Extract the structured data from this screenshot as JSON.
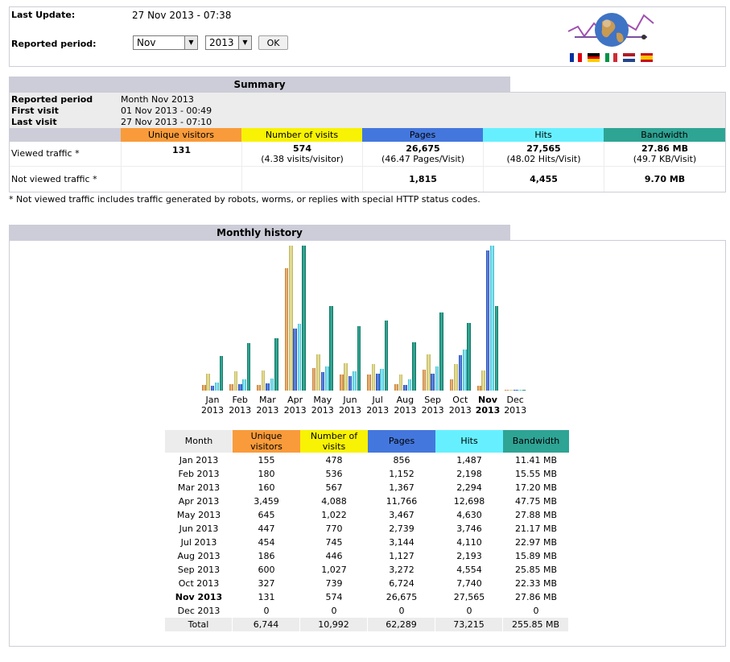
{
  "header": {
    "last_update_label": "Last Update:",
    "last_update_value": "27 Nov 2013 - 07:38",
    "period_label": "Reported period:",
    "month_selected": "Nov",
    "year_selected": "2013",
    "ok_label": "OK",
    "flags": [
      "fr-flag-icon",
      "de-flag-icon",
      "it-flag-icon",
      "nl-flag-icon",
      "es-flag-icon"
    ]
  },
  "summary": {
    "title": "Summary",
    "reported_period_label": "Reported period",
    "reported_period_value": "Month Nov 2013",
    "first_visit_label": "First visit",
    "first_visit_value": "01 Nov 2013 - 00:49",
    "last_visit_label": "Last visit",
    "last_visit_value": "27 Nov 2013 - 07:10",
    "columns": [
      "Unique visitors",
      "Number of visits",
      "Pages",
      "Hits",
      "Bandwidth"
    ],
    "viewed_label": "Viewed traffic *",
    "viewed": {
      "unique": "131",
      "visits": "574",
      "visits_sub": "(4.38 visits/visitor)",
      "pages": "26,675",
      "pages_sub": "(46.47 Pages/Visit)",
      "hits": "27,565",
      "hits_sub": "(48.02 Hits/Visit)",
      "bandwidth": "27.86 MB",
      "bandwidth_sub": "(49.7 KB/Visit)"
    },
    "not_viewed_label": "Not viewed traffic *",
    "not_viewed": {
      "pages": "1,815",
      "hits": "4,455",
      "bandwidth": "9.70 MB"
    },
    "footnote": "* Not viewed traffic includes traffic generated by robots, worms, or replies with special HTTP status codes."
  },
  "colors": {
    "unique": "#f99b3a",
    "visits": "#f8f204",
    "pages": "#4477dd",
    "hits": "#66f0ff",
    "bandwidth": "#2ea495",
    "tab_bg": "#cccdd8"
  },
  "history": {
    "title": "Monthly history",
    "table_headers": [
      "Month",
      "Unique visitors",
      "Number of visits",
      "Pages",
      "Hits",
      "Bandwidth"
    ],
    "rows": [
      {
        "month": "Jan 2013",
        "unique": "155",
        "visits": "478",
        "pages": "856",
        "hits": "1,487",
        "bandwidth": "11.41 MB"
      },
      {
        "month": "Feb 2013",
        "unique": "180",
        "visits": "536",
        "pages": "1,152",
        "hits": "2,198",
        "bandwidth": "15.55 MB"
      },
      {
        "month": "Mar 2013",
        "unique": "160",
        "visits": "567",
        "pages": "1,367",
        "hits": "2,294",
        "bandwidth": "17.20 MB"
      },
      {
        "month": "Apr 2013",
        "unique": "3,459",
        "visits": "4,088",
        "pages": "11,766",
        "hits": "12,698",
        "bandwidth": "47.75 MB"
      },
      {
        "month": "May 2013",
        "unique": "645",
        "visits": "1,022",
        "pages": "3,467",
        "hits": "4,630",
        "bandwidth": "27.88 MB"
      },
      {
        "month": "Jun 2013",
        "unique": "447",
        "visits": "770",
        "pages": "2,739",
        "hits": "3,746",
        "bandwidth": "21.17 MB"
      },
      {
        "month": "Jul 2013",
        "unique": "454",
        "visits": "745",
        "pages": "3,144",
        "hits": "4,110",
        "bandwidth": "22.97 MB"
      },
      {
        "month": "Aug 2013",
        "unique": "186",
        "visits": "446",
        "pages": "1,127",
        "hits": "2,193",
        "bandwidth": "15.89 MB"
      },
      {
        "month": "Sep 2013",
        "unique": "600",
        "visits": "1,027",
        "pages": "3,272",
        "hits": "4,554",
        "bandwidth": "25.85 MB"
      },
      {
        "month": "Oct 2013",
        "unique": "327",
        "visits": "739",
        "pages": "6,724",
        "hits": "7,740",
        "bandwidth": "22.33 MB"
      },
      {
        "month": "Nov 2013",
        "unique": "131",
        "visits": "574",
        "pages": "26,675",
        "hits": "27,565",
        "bandwidth": "27.86 MB"
      },
      {
        "month": "Dec 2013",
        "unique": "0",
        "visits": "0",
        "pages": "0",
        "hits": "0",
        "bandwidth": "0"
      }
    ],
    "total": {
      "month": "Total",
      "unique": "6,744",
      "visits": "10,992",
      "pages": "62,289",
      "hits": "73,215",
      "bandwidth": "255.85 MB"
    }
  },
  "chart_data": {
    "type": "bar",
    "categories": [
      "Jan",
      "Feb",
      "Mar",
      "Apr",
      "May",
      "Jun",
      "Jul",
      "Aug",
      "Sep",
      "Oct",
      "Nov",
      "Dec"
    ],
    "category_years": [
      "2013",
      "2013",
      "2013",
      "2013",
      "2013",
      "2013",
      "2013",
      "2013",
      "2013",
      "2013",
      "2013",
      "2013"
    ],
    "highlight_index": 10,
    "series": [
      {
        "name": "Unique visitors",
        "color": "#f99b3a",
        "values": [
          155,
          180,
          160,
          3459,
          645,
          447,
          454,
          186,
          600,
          327,
          131,
          0
        ]
      },
      {
        "name": "Number of visits",
        "color": "#f8f204",
        "values": [
          478,
          536,
          567,
          4088,
          1022,
          770,
          745,
          446,
          1027,
          739,
          574,
          0
        ]
      },
      {
        "name": "Pages",
        "color": "#4477dd",
        "values": [
          856,
          1152,
          1367,
          11766,
          3467,
          2739,
          3144,
          1127,
          3272,
          6724,
          26675,
          0
        ]
      },
      {
        "name": "Hits",
        "color": "#66f0ff",
        "values": [
          1487,
          2198,
          2294,
          12698,
          4630,
          3746,
          4110,
          2193,
          4554,
          7740,
          27565,
          0
        ]
      },
      {
        "name": "Bandwidth (MB)",
        "color": "#2ea495",
        "values": [
          11.41,
          15.55,
          17.2,
          47.75,
          27.88,
          21.17,
          22.97,
          15.89,
          25.85,
          22.33,
          27.86,
          0
        ]
      }
    ]
  }
}
